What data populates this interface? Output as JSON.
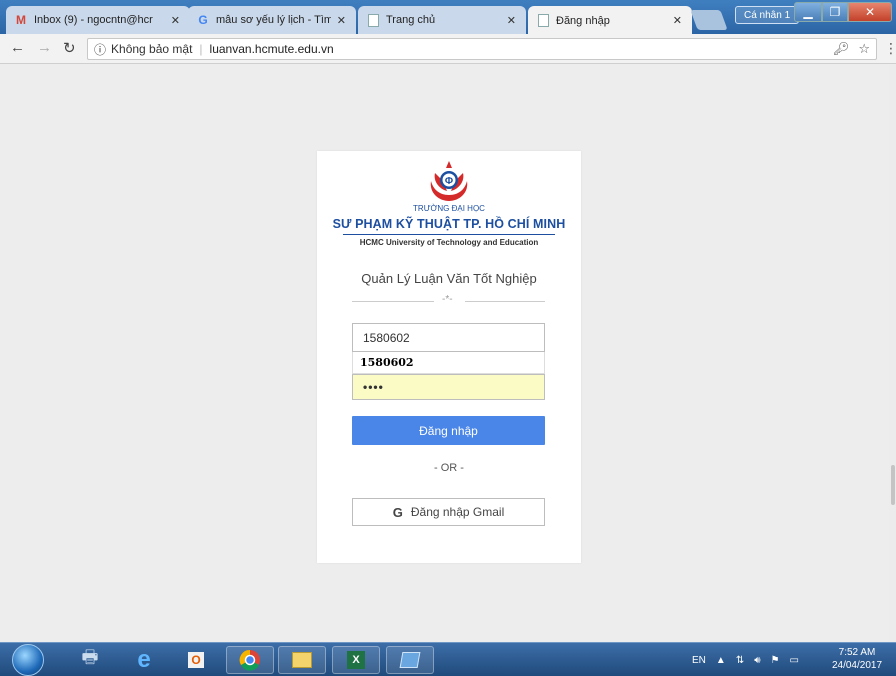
{
  "browser": {
    "tabs": [
      {
        "title": "Inbox (9) - ngocntn@hcr",
        "icon": "gmail-icon"
      },
      {
        "title": "mẫu sơ yếu lý lịch - Tìm",
        "icon": "google-icon"
      },
      {
        "title": "Trang chủ",
        "icon": "page-icon"
      },
      {
        "title": "Đăng nhập",
        "icon": "page-icon",
        "active": true
      }
    ],
    "profile_label": "Cá nhân 1",
    "security_label": "Không bảo mật",
    "url": "luanvan.hcmute.edu.vn"
  },
  "login": {
    "uni_small": "TRƯỜNG ĐẠI HỌC",
    "uni_big": "SƯ PHẠM KỸ THUẬT TP. HỒ CHÍ MINH",
    "uni_en": "HCMC University of Technology and Education",
    "app_title": "Quản Lý Luận Văn Tốt Nghiệp",
    "divider_mark": "-*-",
    "username_value": "1580602",
    "autocomplete_suggestion": "1580602",
    "password_masked": "••••",
    "login_button": "Đăng nhập",
    "or_text": "- OR -",
    "gmail_g": "G",
    "gmail_button": "Đăng nhập Gmail"
  },
  "taskbar": {
    "lang": "EN",
    "time": "7:52 AM",
    "date": "24/04/2017"
  },
  "colors": {
    "primary_button": "#4a86e8",
    "university_blue": "#1d4fa0",
    "autofill_bg": "#fbfbc6"
  }
}
